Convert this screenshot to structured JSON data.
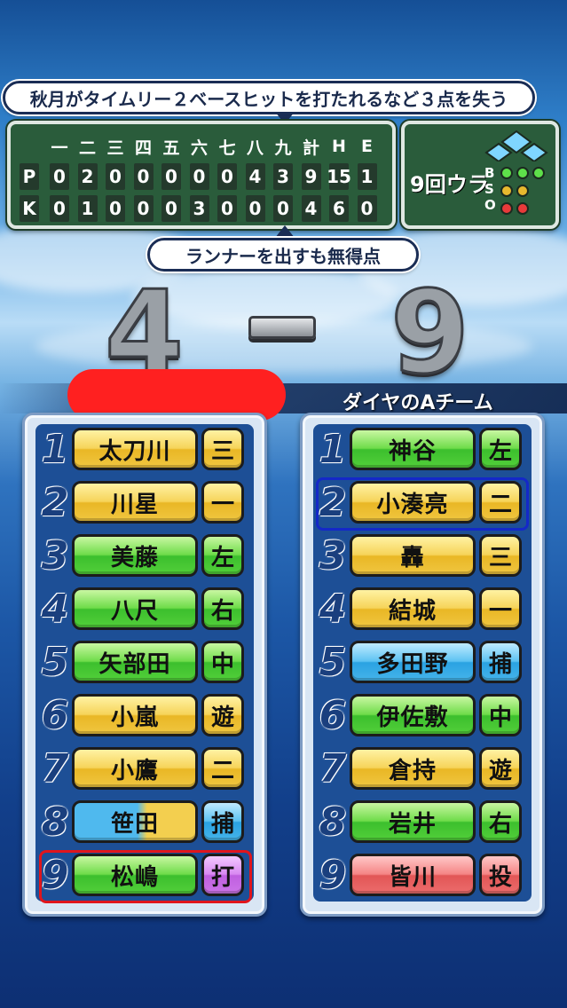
{
  "headline_top": "秋月がタイムリー２ベースヒットを打たれるなど３点を失う",
  "headline_bottom": "ランナーを出すも無得点",
  "scoreboard": {
    "header": [
      "一",
      "二",
      "三",
      "四",
      "五",
      "六",
      "七",
      "八",
      "九",
      "計",
      "H",
      "E"
    ],
    "rows": [
      {
        "team": "P",
        "cells": [
          "0",
          "2",
          "0",
          "0",
          "0",
          "0",
          "0",
          "4",
          "3",
          "9",
          "15",
          "1"
        ]
      },
      {
        "team": "K",
        "cells": [
          "0",
          "1",
          "0",
          "0",
          "0",
          "3",
          "0",
          "0",
          "0",
          "4",
          "6",
          "0"
        ]
      }
    ]
  },
  "inning": {
    "label": "9回ウラ",
    "b": "B",
    "s": "S",
    "o": "O",
    "balls": 3,
    "strikes": 2,
    "outs": 2
  },
  "score": {
    "left": "4",
    "dash": "-",
    "right": "9"
  },
  "right_team_name": "ダイヤのAチーム",
  "colors": {
    "yellow": "#f3cf4f",
    "green": "#52cf3a",
    "blue": "#45b4ea",
    "red": "#ec6c6c",
    "purple": "#cc74e8",
    "highlight_red": "#e0151c",
    "highlight_blue": "#1428c8",
    "redaction": "#ff2020"
  },
  "left_lineup": [
    {
      "num": "1",
      "name": "太刀川",
      "pos": "三",
      "name_color": "yellow",
      "pos_color": "yellow"
    },
    {
      "num": "2",
      "name": "川星",
      "pos": "一",
      "name_color": "yellow",
      "pos_color": "yellow"
    },
    {
      "num": "3",
      "name": "美藤",
      "pos": "左",
      "name_color": "green",
      "pos_color": "green"
    },
    {
      "num": "4",
      "name": "八尺",
      "pos": "右",
      "name_color": "green",
      "pos_color": "green"
    },
    {
      "num": "5",
      "name": "矢部田",
      "pos": "中",
      "name_color": "green",
      "pos_color": "green"
    },
    {
      "num": "6",
      "name": "小嵐",
      "pos": "遊",
      "name_color": "yellow",
      "pos_color": "yellow"
    },
    {
      "num": "7",
      "name": "小鷹",
      "pos": "二",
      "name_color": "yellow",
      "pos_color": "yellow"
    },
    {
      "num": "8",
      "name": "笹田",
      "pos": "捕",
      "name_color": "split",
      "pos_color": "blue"
    },
    {
      "num": "9",
      "name": "松嶋",
      "pos": "打",
      "name_color": "green",
      "pos_color": "purple"
    }
  ],
  "right_lineup": [
    {
      "num": "1",
      "name": "神谷",
      "pos": "左",
      "name_color": "green",
      "pos_color": "green"
    },
    {
      "num": "2",
      "name": "小湊亮",
      "pos": "二",
      "name_color": "yellow",
      "pos_color": "yellow"
    },
    {
      "num": "3",
      "name": "轟",
      "pos": "三",
      "name_color": "yellow",
      "pos_color": "yellow"
    },
    {
      "num": "4",
      "name": "結城",
      "pos": "一",
      "name_color": "yellow",
      "pos_color": "yellow"
    },
    {
      "num": "5",
      "name": "多田野",
      "pos": "捕",
      "name_color": "blue",
      "pos_color": "blue"
    },
    {
      "num": "6",
      "name": "伊佐敷",
      "pos": "中",
      "name_color": "green",
      "pos_color": "green"
    },
    {
      "num": "7",
      "name": "倉持",
      "pos": "遊",
      "name_color": "yellow",
      "pos_color": "yellow"
    },
    {
      "num": "8",
      "name": "岩井",
      "pos": "右",
      "name_color": "green",
      "pos_color": "green"
    },
    {
      "num": "9",
      "name": "皆川",
      "pos": "投",
      "name_color": "red",
      "pos_color": "red"
    }
  ]
}
